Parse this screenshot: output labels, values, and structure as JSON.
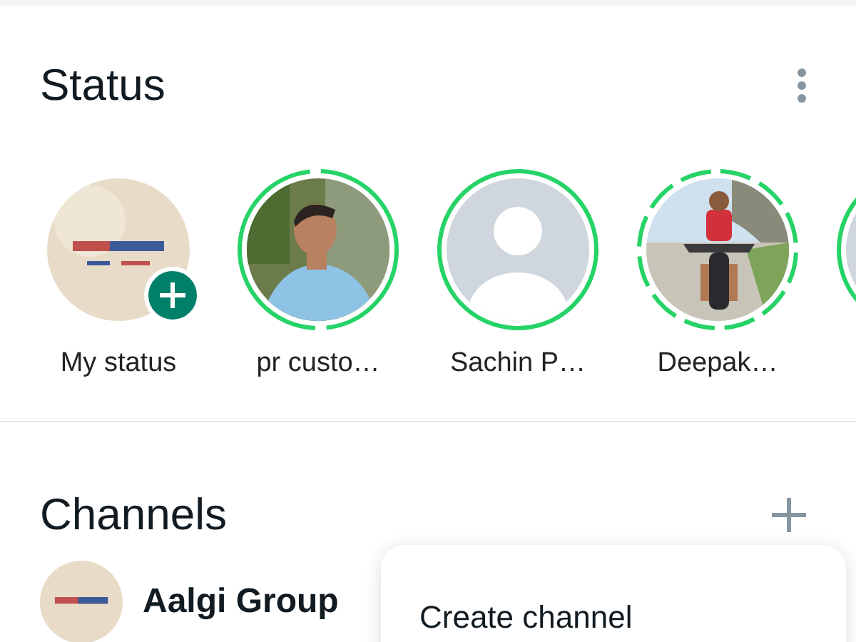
{
  "status": {
    "title": "Status",
    "items": [
      {
        "name": "My status",
        "kind": "mine",
        "add": true
      },
      {
        "name": "pr custo…",
        "kind": "person",
        "ring": {
          "kind": "split"
        },
        "add": false
      },
      {
        "name": "Sachin P…",
        "kind": "default",
        "ring": {
          "kind": "solid"
        },
        "add": false
      },
      {
        "name": "Deepak…",
        "kind": "rider",
        "ring": {
          "kind": "dashed"
        },
        "add": false
      },
      {
        "kind": "default",
        "ring": {
          "kind": "solid"
        },
        "add": false
      }
    ]
  },
  "channels": {
    "title": "Channels",
    "items": [
      {
        "name": "Aalgi Group",
        "kind": "mine"
      }
    ]
  },
  "menu": {
    "items": [
      "Create channel"
    ]
  }
}
